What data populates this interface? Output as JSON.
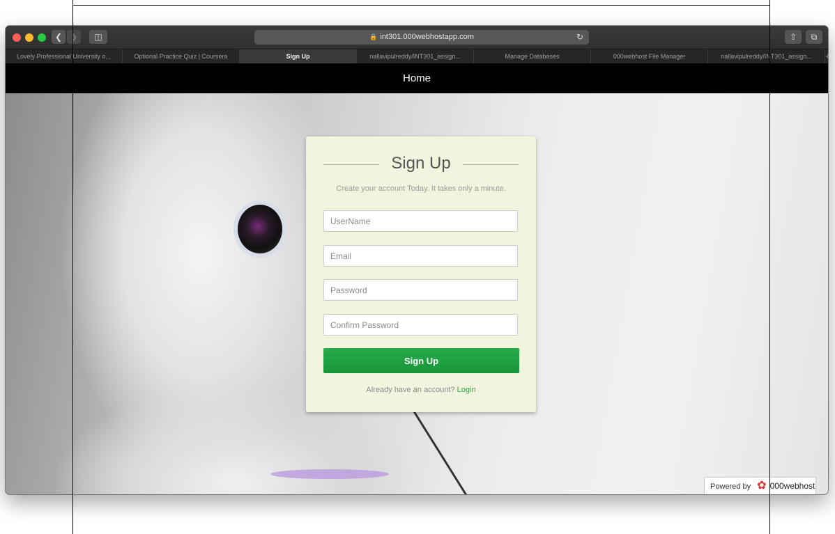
{
  "browser": {
    "url": "int301.000webhostapp.com",
    "tabs": [
      {
        "label": "Lovely Professional University o...",
        "active": false
      },
      {
        "label": "Optional Practice Quiz | Coursera",
        "active": false
      },
      {
        "label": "Sign Up",
        "active": true
      },
      {
        "label": "nallavipulreddy/INT301_assign...",
        "active": false
      },
      {
        "label": "Manage Databases",
        "active": false
      },
      {
        "label": "000webhost File Manager",
        "active": false
      },
      {
        "label": "nallavipulreddy/INT301_assign...",
        "active": false
      }
    ],
    "new_tab_symbol": "+"
  },
  "navbar": {
    "home_label": "Home"
  },
  "form": {
    "title": "Sign Up",
    "subtitle": "Create your account Today. It takes only a minute.",
    "username_placeholder": "UserName",
    "email_placeholder": "Email",
    "password_placeholder": "Password",
    "confirm_placeholder": "Confirm Password",
    "submit_label": "Sign Up",
    "login_prompt": "Already have an account?",
    "login_link": "Login"
  },
  "footer_badge": {
    "powered_by": "Powered by",
    "brand": "000webhost"
  },
  "colors": {
    "card_bg": "#f2f4de",
    "button_green": "#1f9f43",
    "link_green": "#2ea447"
  }
}
